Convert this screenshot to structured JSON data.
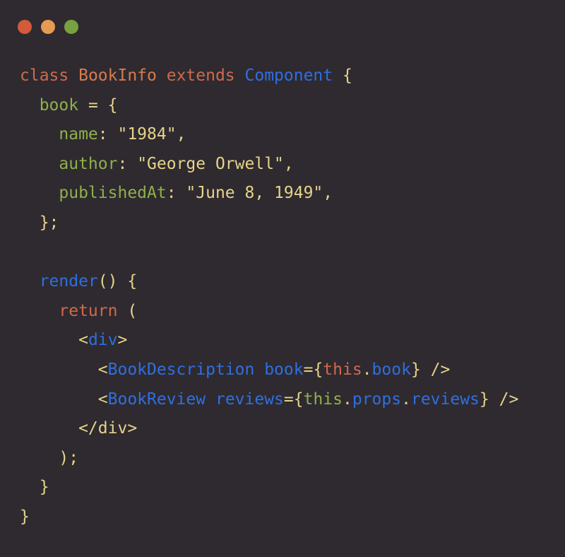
{
  "window": {
    "controls": [
      {
        "name": "close",
        "color": "#d35a3a"
      },
      {
        "name": "minimize",
        "color": "#e79a52"
      },
      {
        "name": "maximize",
        "color": "#78a13f"
      }
    ]
  },
  "colors": {
    "keyword": "#cf6a4c",
    "class": "#d97a4e",
    "type": "#2f6fe0",
    "property": "#8fb04a",
    "string": "#e6d38a",
    "punct": "#e6d38a",
    "tag": "#2f6fe0",
    "attr": "#2f6fe0",
    "this": "#cf6a4c",
    "thisprop": "#8fb04a"
  },
  "code": {
    "lines": [
      [
        {
          "t": "class ",
          "c": "keyword"
        },
        {
          "t": "BookInfo",
          "c": "class"
        },
        {
          "t": " extends ",
          "c": "keyword"
        },
        {
          "t": "Component",
          "c": "type"
        },
        {
          "t": " {",
          "c": "punct"
        }
      ],
      [
        {
          "t": "  ",
          "c": "punct"
        },
        {
          "t": "book",
          "c": "property"
        },
        {
          "t": " = {",
          "c": "punct"
        }
      ],
      [
        {
          "t": "    ",
          "c": "punct"
        },
        {
          "t": "name",
          "c": "property"
        },
        {
          "t": ": ",
          "c": "punct"
        },
        {
          "t": "\"1984\"",
          "c": "string"
        },
        {
          "t": ",",
          "c": "punct"
        }
      ],
      [
        {
          "t": "    ",
          "c": "punct"
        },
        {
          "t": "author",
          "c": "property"
        },
        {
          "t": ": ",
          "c": "punct"
        },
        {
          "t": "\"George Orwell\"",
          "c": "string"
        },
        {
          "t": ",",
          "c": "punct"
        }
      ],
      [
        {
          "t": "    ",
          "c": "punct"
        },
        {
          "t": "publishedAt",
          "c": "property"
        },
        {
          "t": ": ",
          "c": "punct"
        },
        {
          "t": "\"June 8, 1949\"",
          "c": "string"
        },
        {
          "t": ",",
          "c": "punct"
        }
      ],
      [
        {
          "t": "  };",
          "c": "punct"
        }
      ],
      [],
      [
        {
          "t": "  ",
          "c": "punct"
        },
        {
          "t": "render",
          "c": "type"
        },
        {
          "t": "() {",
          "c": "punct"
        }
      ],
      [
        {
          "t": "    ",
          "c": "punct"
        },
        {
          "t": "return",
          "c": "keyword"
        },
        {
          "t": " (",
          "c": "punct"
        }
      ],
      [
        {
          "t": "      <",
          "c": "punct"
        },
        {
          "t": "div",
          "c": "tag"
        },
        {
          "t": ">",
          "c": "punct"
        }
      ],
      [
        {
          "t": "        <",
          "c": "punct"
        },
        {
          "t": "BookDescription",
          "c": "tag"
        },
        {
          "t": " ",
          "c": "punct"
        },
        {
          "t": "book",
          "c": "attr"
        },
        {
          "t": "={",
          "c": "punct"
        },
        {
          "t": "this",
          "c": "this"
        },
        {
          "t": ".",
          "c": "punct"
        },
        {
          "t": "book",
          "c": "attr"
        },
        {
          "t": "} />",
          "c": "punct"
        }
      ],
      [
        {
          "t": "        <",
          "c": "punct"
        },
        {
          "t": "BookReview",
          "c": "tag"
        },
        {
          "t": " ",
          "c": "punct"
        },
        {
          "t": "reviews",
          "c": "attr"
        },
        {
          "t": "={",
          "c": "punct"
        },
        {
          "t": "this",
          "c": "thisprop"
        },
        {
          "t": ".",
          "c": "punct"
        },
        {
          "t": "props",
          "c": "attr"
        },
        {
          "t": ".",
          "c": "punct"
        },
        {
          "t": "reviews",
          "c": "attr"
        },
        {
          "t": "} />",
          "c": "punct"
        }
      ],
      [
        {
          "t": "      </div>",
          "c": "punct"
        }
      ],
      [
        {
          "t": "    );",
          "c": "punct"
        }
      ],
      [
        {
          "t": "  }",
          "c": "punct"
        }
      ],
      [
        {
          "t": "}",
          "c": "punct"
        }
      ]
    ]
  }
}
